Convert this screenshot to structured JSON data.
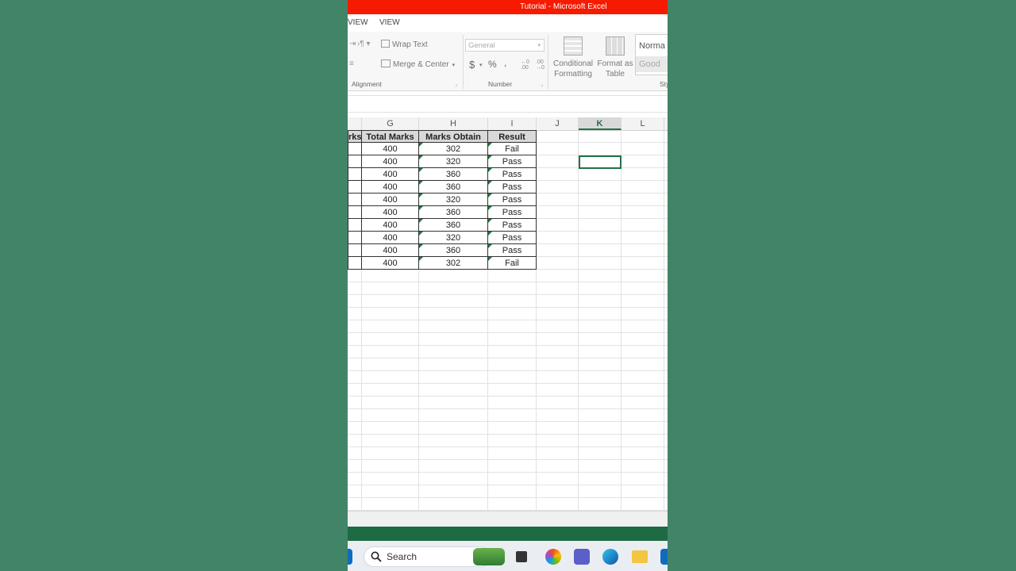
{
  "window": {
    "title": "Tutorial -  Microsoft Excel"
  },
  "ribbon_tabs": [
    "VIEW",
    "VIEW"
  ],
  "ribbon": {
    "alignment": {
      "wrap_text": "Wrap Text",
      "merge_center": "Merge & Center",
      "group_label": "Alignment"
    },
    "number": {
      "format_value": "General",
      "currency": "$",
      "percent": "%",
      "comma": ",",
      "group_label": "Number"
    },
    "styles": {
      "conditional_formatting": "Conditional Formatting",
      "format_as_table": "Format as Table",
      "style_normal": "Norma",
      "style_good": "Good",
      "group_label": "Sty"
    }
  },
  "sheet": {
    "column_headers": [
      "G",
      "H",
      "I",
      "J",
      "K",
      "L"
    ],
    "selected_column": "K",
    "table_headers": [
      "rks",
      "Total Marks",
      "Marks Obtain",
      "Result"
    ],
    "rows": [
      {
        "total": "400",
        "obtained": "302",
        "result": "Fail"
      },
      {
        "total": "400",
        "obtained": "320",
        "result": "Pass"
      },
      {
        "total": "400",
        "obtained": "360",
        "result": "Pass"
      },
      {
        "total": "400",
        "obtained": "360",
        "result": "Pass"
      },
      {
        "total": "400",
        "obtained": "320",
        "result": "Pass"
      },
      {
        "total": "400",
        "obtained": "360",
        "result": "Pass"
      },
      {
        "total": "400",
        "obtained": "360",
        "result": "Pass"
      },
      {
        "total": "400",
        "obtained": "320",
        "result": "Pass"
      },
      {
        "total": "400",
        "obtained": "360",
        "result": "Pass"
      },
      {
        "total": "400",
        "obtained": "302",
        "result": "Fail"
      }
    ]
  },
  "taskbar": {
    "search_label": "Search"
  },
  "colors": {
    "title_bar": "#f51a00",
    "excel_green": "#217346",
    "background": "#418467"
  }
}
